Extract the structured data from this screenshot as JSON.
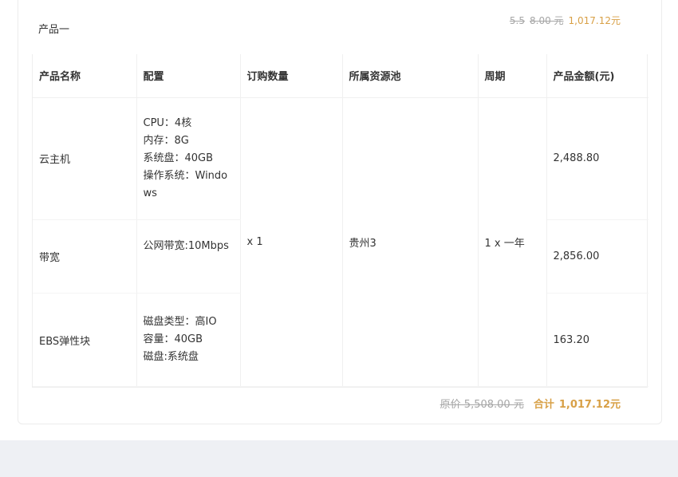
{
  "product": {
    "title": "产品一",
    "original_discount": "5.5",
    "original_price": "8.00 元",
    "price": "1,017.12元"
  },
  "table": {
    "headers": [
      "产品名称",
      "配置",
      "订购数量",
      "所属资源池",
      "周期",
      "产品金额(元)"
    ],
    "rows": [
      {
        "name": "云主机",
        "config": [
          "CPU：4核",
          "内存：8G",
          "系统盘：40GB",
          "操作系统：Windows"
        ],
        "amount": "2,488.80"
      },
      {
        "name": "带宽",
        "config": [
          "公网带宽:10Mbps"
        ],
        "amount": "2,856.00"
      },
      {
        "name": "EBS弹性块",
        "config": [
          "磁盘类型：高IO",
          "容量：40GB",
          "磁盘:系统盘"
        ],
        "amount": "163.20"
      }
    ],
    "quantity": "x 1",
    "resource_pool": "贵州3",
    "period": "1 x 一年"
  },
  "summary": {
    "original_label": "原价 5,508.00 元",
    "total_label": "合计",
    "total_value": "1,017.12元"
  },
  "colors": {
    "accent": "#d8a046",
    "muted": "#a6a6a6",
    "footer_bg": "#eef0f4"
  }
}
